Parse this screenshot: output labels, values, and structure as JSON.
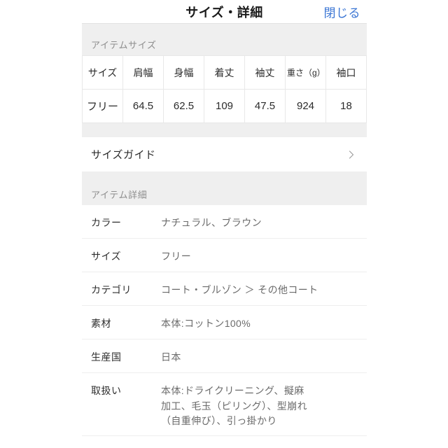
{
  "header": {
    "title": "サイズ・詳細",
    "close_label": "閉じる",
    "close_color": "#3b76d4"
  },
  "size_section": {
    "band_label": "アイテムサイズ",
    "table": {
      "columns": [
        "サイズ",
        "肩幅",
        "身幅",
        "着丈",
        "袖丈",
        "重さ（g）",
        "袖口"
      ],
      "rows": [
        [
          "フリー",
          "64.5",
          "62.5",
          "109",
          "47.5",
          "924",
          "18"
        ]
      ]
    }
  },
  "size_guide": {
    "label": "サイズガイド",
    "chevron_icon": "chevron-right-icon"
  },
  "detail_section": {
    "band_label": "アイテム詳細",
    "rows": [
      {
        "label": "カラー",
        "value": "ナチュラル、ブラウン"
      },
      {
        "label": "サイズ",
        "value": "フリー"
      },
      {
        "label": "カテゴリ",
        "value": "コート・ブルゾン ＞ その他コート"
      },
      {
        "label": "素材",
        "value": "本体:コットン100%"
      },
      {
        "label": "生産国",
        "value": "日本"
      },
      {
        "label": "取扱い",
        "value": "本体:ドライクリーニング、擬麻加工、毛玉（ピリング）、型崩れ（自重伸び）、引っ掛かり"
      }
    ]
  },
  "colors": {
    "band_background": "#efefef",
    "band_text": "#8e8e8e",
    "divider": "#eeeeee",
    "table_border": "#e8e8e8",
    "label_text": "#2f2f2f",
    "value_text": "#6b6b6b"
  }
}
